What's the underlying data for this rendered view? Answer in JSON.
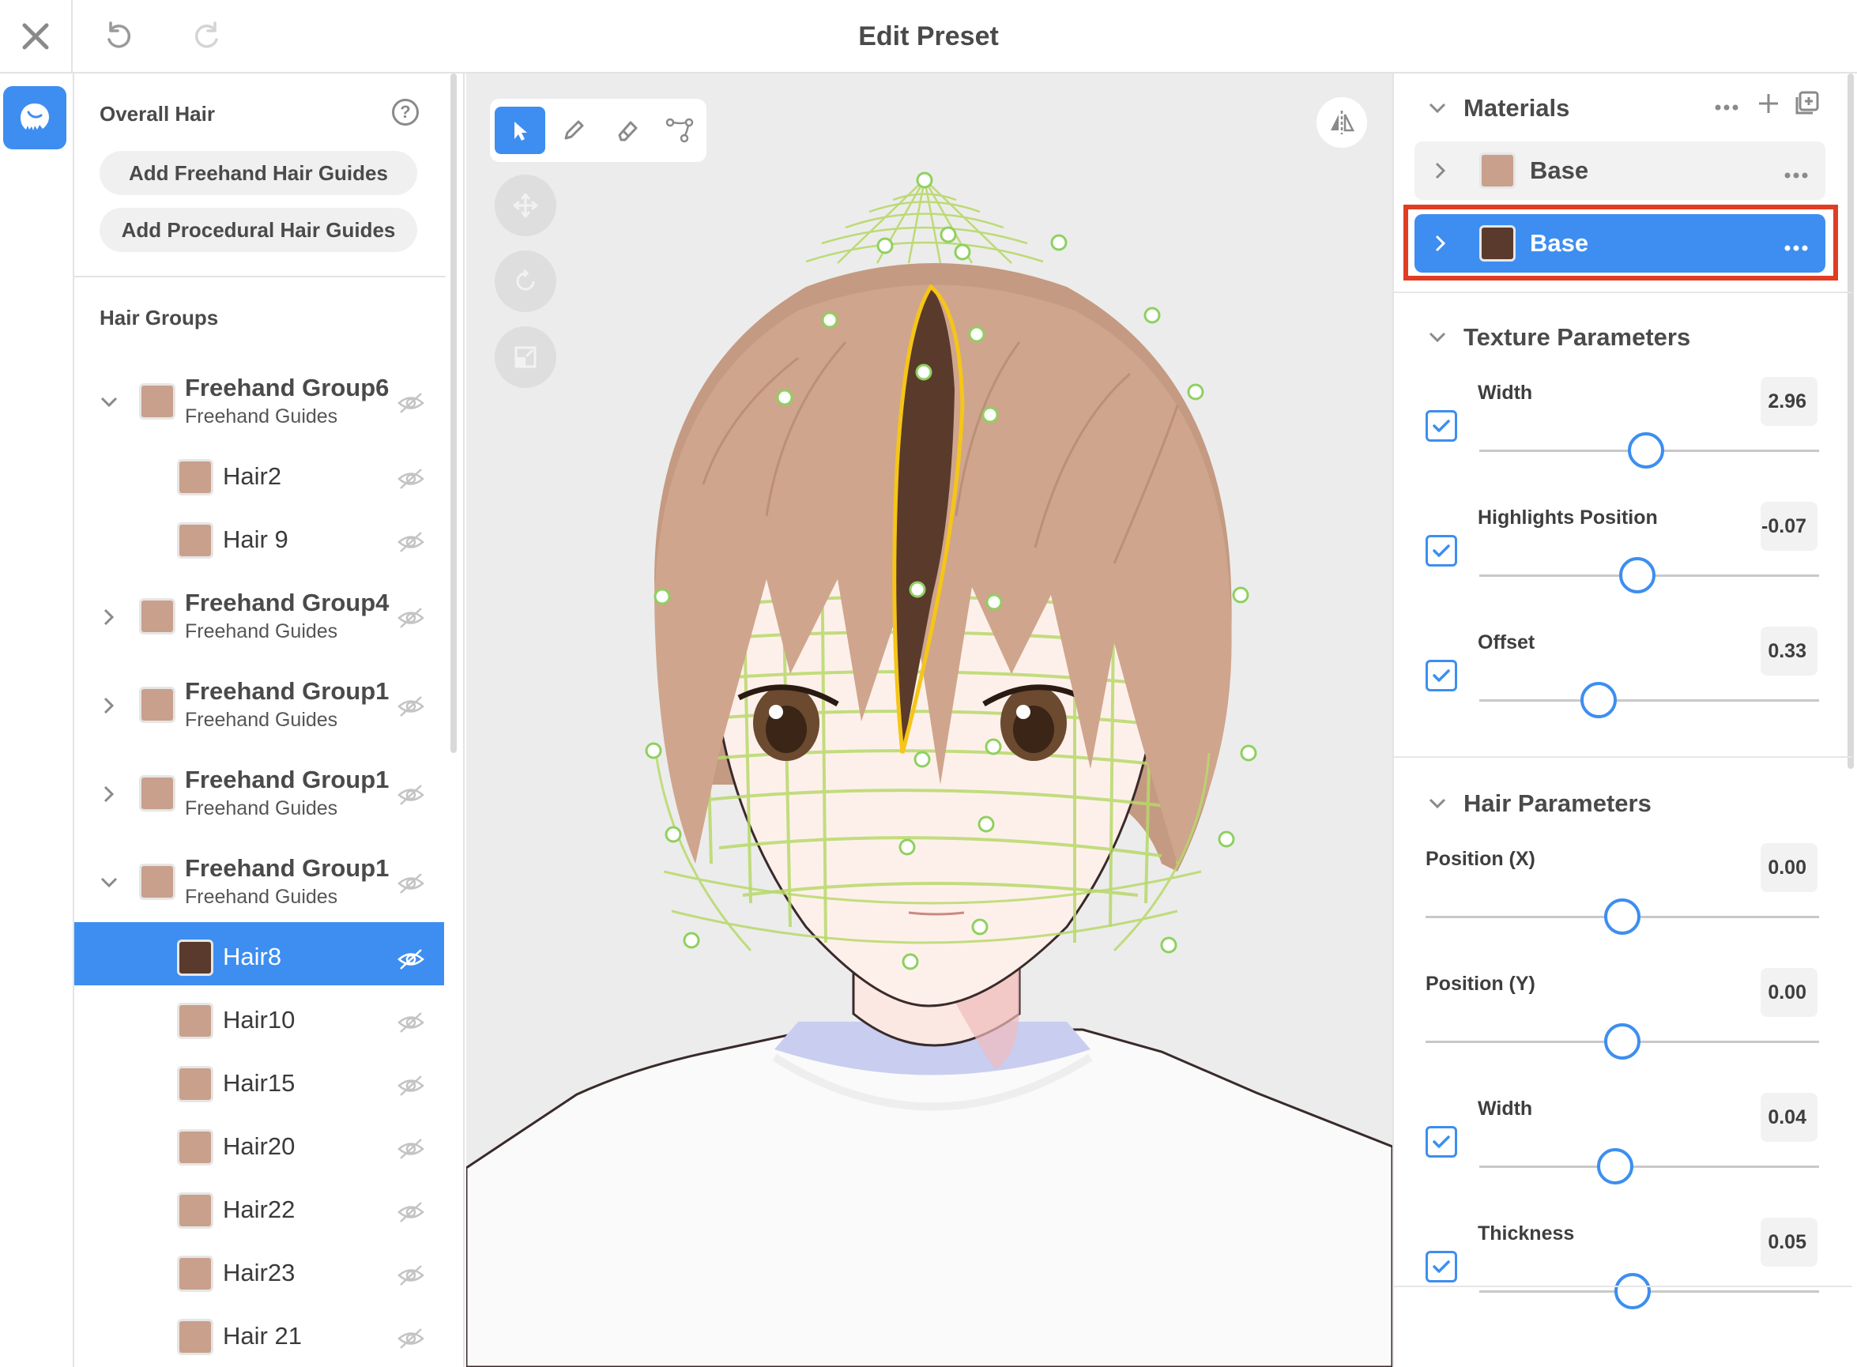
{
  "header": {
    "title": "Edit Preset",
    "close_icon": "close-icon",
    "undo_icon": "undo-icon",
    "redo_icon": "redo-icon"
  },
  "rail": {
    "hair_mode_icon": "hair-head-icon"
  },
  "left_panel": {
    "overall_title": "Overall Hair",
    "help_glyph": "?",
    "add_freehand_label": "Add Freehand Hair Guides",
    "add_procedural_label": "Add Procedural Hair Guides",
    "groups_title": "Hair Groups",
    "items": [
      {
        "type": "group",
        "name": "Freehand Group6",
        "sub": "Freehand Guides",
        "expanded": true,
        "color": "#c9a08c"
      },
      {
        "type": "child",
        "name": "Hair2",
        "color": "#c9a08c"
      },
      {
        "type": "child",
        "name": "Hair 9",
        "color": "#c9a08c"
      },
      {
        "type": "group",
        "name": "Freehand Group4",
        "sub": "Freehand Guides",
        "expanded": false,
        "color": "#c9a08c"
      },
      {
        "type": "group",
        "name": "Freehand Group1",
        "sub": "Freehand Guides",
        "expanded": false,
        "color": "#c9a08c"
      },
      {
        "type": "group",
        "name": "Freehand Group1",
        "sub": "Freehand Guides",
        "expanded": false,
        "color": "#c9a08c"
      },
      {
        "type": "group",
        "name": "Freehand Group1",
        "sub": "Freehand Guides",
        "expanded": true,
        "color": "#c9a08c"
      },
      {
        "type": "child",
        "name": "Hair8",
        "color": "#5a3a2c",
        "selected": true
      },
      {
        "type": "child",
        "name": "Hair10",
        "color": "#c9a08c"
      },
      {
        "type": "child",
        "name": "Hair15",
        "color": "#c9a08c"
      },
      {
        "type": "child",
        "name": "Hair20",
        "color": "#c9a08c"
      },
      {
        "type": "child",
        "name": "Hair22",
        "color": "#c9a08c"
      },
      {
        "type": "child",
        "name": "Hair23",
        "color": "#c9a08c"
      },
      {
        "type": "child",
        "name": "Hair 21",
        "color": "#c9a08c"
      }
    ]
  },
  "viewport": {
    "tools": [
      "select-arrow-icon",
      "pen-icon",
      "eraser-icon",
      "path-edit-icon"
    ],
    "active_tool": "select-arrow-icon",
    "transform_tools": [
      "move-icon",
      "rotate-icon",
      "scale-icon"
    ],
    "mirror_icon": "mirror-icon",
    "hair_light_color": "#c8a08a",
    "hair_selected_color": "#5a3a2a",
    "guide_color": "#b8d96a",
    "selection_outline_color": "#f5c518"
  },
  "right_panel": {
    "materials": {
      "title": "Materials",
      "items": [
        {
          "name": "Base",
          "color": "#c9a08c",
          "selected": false
        },
        {
          "name": "Base",
          "color": "#5a3a2c",
          "selected": true
        }
      ]
    },
    "texture_params": {
      "title": "Texture Parameters",
      "params": [
        {
          "label": "Width",
          "value": "2.96",
          "checked": true,
          "fraction": 0.49
        },
        {
          "label": "Highlights Position",
          "value": "-0.07",
          "checked": true,
          "fraction": 0.465
        },
        {
          "label": "Offset",
          "value": "0.33",
          "checked": true,
          "fraction": 0.35
        }
      ]
    },
    "hair_params": {
      "title": "Hair Parameters",
      "params": [
        {
          "label": "Position (X)",
          "value": "0.00",
          "checked": null,
          "fraction": 0.5
        },
        {
          "label": "Position (Y)",
          "value": "0.00",
          "checked": null,
          "fraction": 0.5
        },
        {
          "label": "Width",
          "value": "0.04",
          "checked": true,
          "fraction": 0.4
        },
        {
          "label": "Thickness",
          "value": "0.05",
          "checked": true,
          "fraction": 0.45
        }
      ]
    },
    "accent_color": "#3d8ef0",
    "highlight_color": "#e03d23"
  }
}
